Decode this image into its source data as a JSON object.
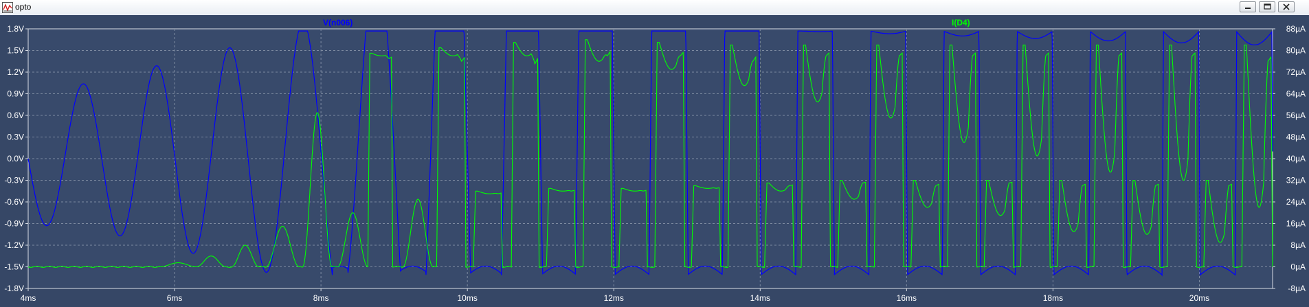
{
  "window": {
    "title": "opto",
    "icon": "waveform-viewer-icon",
    "buttons": [
      "minimize-icon",
      "restore-icon",
      "close-icon"
    ]
  },
  "colors": {
    "plot_background": "#384a6b",
    "frame_background": "#364766",
    "grid": "#7d8aa0",
    "v_trace": "#0000ff",
    "i_trace": "#00ff00",
    "tick_text": "#ffffff"
  },
  "chart_data": {
    "type": "line",
    "title": "",
    "x_axis": {
      "unit": "ms",
      "range": [
        4.0,
        21.0
      ],
      "ticks": [
        4,
        6,
        8,
        10,
        12,
        14,
        16,
        18,
        20
      ],
      "tick_labels": [
        "4ms",
        "6ms",
        "8ms",
        "10ms",
        "12ms",
        "14ms",
        "16ms",
        "18ms",
        "20ms"
      ]
    },
    "y_left": {
      "unit": "V",
      "range": [
        -1.8,
        1.8
      ],
      "ticks": [
        1.8,
        1.5,
        1.2,
        0.9,
        0.6,
        0.3,
        0.0,
        -0.3,
        -0.6,
        -0.9,
        -1.2,
        -1.5,
        -1.8
      ],
      "tick_labels": [
        "1.8V",
        "1.5V",
        "1.2V",
        "0.9V",
        "0.6V",
        "0.3V",
        "0.0V",
        "-0.3V",
        "-0.6V",
        "-0.9V",
        "-1.2V",
        "-1.5V",
        "-1.8V"
      ]
    },
    "y_right": {
      "unit": "µA",
      "range": [
        -8,
        88
      ],
      "ticks": [
        88,
        80,
        72,
        64,
        56,
        48,
        40,
        32,
        24,
        16,
        8,
        0,
        -8
      ],
      "tick_labels": [
        "88µA",
        "80µA",
        "72µA",
        "64µA",
        "56µA",
        "48µA",
        "40µA",
        "32µA",
        "24µA",
        "16µA",
        "8µA",
        "0µA",
        "-8µA"
      ]
    },
    "grid": true,
    "series": [
      {
        "name": "V(n006)",
        "axis": "left",
        "color": "#0000ff",
        "period_ms": 1.0,
        "envelope_points": [
          {
            "t": 4.0,
            "amp": 0.9
          },
          {
            "t": 5.0,
            "amp": 1.05
          },
          {
            "t": 6.0,
            "amp": 1.3
          },
          {
            "t": 7.0,
            "amp": 1.55
          },
          {
            "t": 8.0,
            "amp": 1.9
          },
          {
            "t": 9.0,
            "amp": 3.0
          },
          {
            "t": 10.0,
            "amp": 6.0
          },
          {
            "t": 12.0,
            "amp": 14.0
          },
          {
            "t": 21.0,
            "amp": 30.0
          }
        ],
        "offset_points": [
          {
            "t": 4.0,
            "v": 0.0
          },
          {
            "t": 5.5,
            "v": 0.05
          },
          {
            "t": 7.0,
            "v": 0.05
          },
          {
            "t": 8.0,
            "v": 0.1
          },
          {
            "t": 21.0,
            "v": 0.1
          }
        ],
        "clip": {
          "high": 1.77,
          "low": -1.62
        },
        "clip_low_scallop_depth_v": 0.13,
        "top_scallop": [
          {
            "t": 14.5,
            "depth_v": 0.0
          },
          {
            "t": 16.5,
            "depth_v": 0.06
          },
          {
            "t": 18.5,
            "depth_v": 0.13
          },
          {
            "t": 21.0,
            "depth_v": 0.2
          }
        ]
      },
      {
        "name": "I(D4)",
        "axis": "right",
        "color": "#00ff00",
        "baseline_uA": 0.0,
        "noise_uA": 0.2,
        "pulses": [
          {
            "start_ms": 5.8,
            "end_ms": 6.3,
            "shape": "bump",
            "peak_uA": 1.5
          },
          {
            "start_ms": 6.3,
            "end_ms": 6.7,
            "shape": "bump",
            "peak_uA": 4.0
          },
          {
            "start_ms": 6.78,
            "end_ms": 7.15,
            "shape": "bump",
            "peak_uA": 8.0
          },
          {
            "start_ms": 7.25,
            "end_ms": 7.7,
            "shape": "bump",
            "peak_uA": 15.0
          },
          {
            "start_ms": 7.75,
            "end_ms": 8.15,
            "shape": "bump",
            "peak_uA": 57.0
          },
          {
            "start_ms": 8.23,
            "end_ms": 8.64,
            "shape": "bump",
            "peak_uA": 20.0
          },
          {
            "start_ms": 8.64,
            "end_ms": 8.98,
            "shape": "flat",
            "plateau_uA": 77.0,
            "peak_uA": 79.0,
            "dip_uA": 78.0
          },
          {
            "start_ms": 9.12,
            "end_ms": 9.53,
            "shape": "bump",
            "peak_uA": 25.0
          },
          {
            "start_ms": 9.58,
            "end_ms": 9.98,
            "shape": "flat",
            "plateau_uA": 76.0,
            "peak_uA": 81.0,
            "dip_uA": 78.0
          },
          {
            "start_ms": 10.08,
            "end_ms": 10.48,
            "shape": "flat",
            "plateau_uA": 27.0,
            "peak_uA": 28.0,
            "dip_uA": 27.0
          },
          {
            "start_ms": 10.6,
            "end_ms": 10.98,
            "shape": "flat",
            "plateau_uA": 75.0,
            "peak_uA": 83.0,
            "dip_uA": 78.0
          },
          {
            "start_ms": 11.08,
            "end_ms": 11.48,
            "shape": "flat",
            "plateau_uA": 28.0,
            "peak_uA": 29.0,
            "dip_uA": 28.0
          },
          {
            "start_ms": 11.58,
            "end_ms": 11.97,
            "shape": "flat",
            "plateau_uA": 78.0,
            "peak_uA": 84.0,
            "dip_uA": 76.0
          },
          {
            "start_ms": 12.07,
            "end_ms": 12.46,
            "shape": "flat",
            "plateau_uA": 28.0,
            "peak_uA": 29.0,
            "dip_uA": 28.0
          },
          {
            "start_ms": 12.56,
            "end_ms": 12.97,
            "shape": "flat",
            "plateau_uA": 78.0,
            "peak_uA": 83.0,
            "dip_uA": 73.0
          },
          {
            "start_ms": 13.06,
            "end_ms": 13.46,
            "shape": "flat",
            "plateau_uA": 29.0,
            "peak_uA": 30.0,
            "dip_uA": 29.0
          },
          {
            "start_ms": 13.56,
            "end_ms": 13.96,
            "shape": "flat",
            "plateau_uA": 76.0,
            "peak_uA": 82.0,
            "dip_uA": 67.0
          },
          {
            "start_ms": 14.06,
            "end_ms": 14.46,
            "shape": "flat",
            "plateau_uA": 30.0,
            "peak_uA": 31.0,
            "dip_uA": 28.0
          },
          {
            "start_ms": 14.56,
            "end_ms": 14.96,
            "shape": "flat",
            "plateau_uA": 78.0,
            "peak_uA": 82.0,
            "dip_uA": 61.0
          },
          {
            "start_ms": 15.06,
            "end_ms": 15.46,
            "shape": "flat",
            "plateau_uA": 31.0,
            "peak_uA": 32.0,
            "dip_uA": 25.0
          },
          {
            "start_ms": 15.56,
            "end_ms": 15.96,
            "shape": "flat",
            "plateau_uA": 78.0,
            "peak_uA": 82.0,
            "dip_uA": 55.0
          },
          {
            "start_ms": 16.06,
            "end_ms": 16.46,
            "shape": "flat",
            "plateau_uA": 30.0,
            "peak_uA": 32.0,
            "dip_uA": 22.0
          },
          {
            "start_ms": 16.56,
            "end_ms": 16.96,
            "shape": "flat",
            "plateau_uA": 78.0,
            "peak_uA": 82.0,
            "dip_uA": 46.0
          },
          {
            "start_ms": 17.06,
            "end_ms": 17.46,
            "shape": "flat",
            "plateau_uA": 31.0,
            "peak_uA": 32.0,
            "dip_uA": 19.0
          },
          {
            "start_ms": 17.56,
            "end_ms": 17.96,
            "shape": "flat",
            "plateau_uA": 78.0,
            "peak_uA": 82.0,
            "dip_uA": 41.0
          },
          {
            "start_ms": 18.06,
            "end_ms": 18.46,
            "shape": "flat",
            "plateau_uA": 30.0,
            "peak_uA": 32.0,
            "dip_uA": 13.0
          },
          {
            "start_ms": 18.56,
            "end_ms": 18.96,
            "shape": "flat",
            "plateau_uA": 78.0,
            "peak_uA": 82.0,
            "dip_uA": 35.0
          },
          {
            "start_ms": 19.06,
            "end_ms": 19.46,
            "shape": "flat",
            "plateau_uA": 30.0,
            "peak_uA": 32.0,
            "dip_uA": 12.0
          },
          {
            "start_ms": 19.56,
            "end_ms": 19.96,
            "shape": "flat",
            "plateau_uA": 78.0,
            "peak_uA": 82.0,
            "dip_uA": 32.0
          },
          {
            "start_ms": 20.06,
            "end_ms": 20.46,
            "shape": "flat",
            "plateau_uA": 30.0,
            "peak_uA": 32.0,
            "dip_uA": 9.0
          },
          {
            "start_ms": 20.58,
            "end_ms": 21.0,
            "shape": "flat",
            "plateau_uA": 76.0,
            "peak_uA": 82.0,
            "dip_uA": 22.0
          }
        ]
      }
    ]
  }
}
